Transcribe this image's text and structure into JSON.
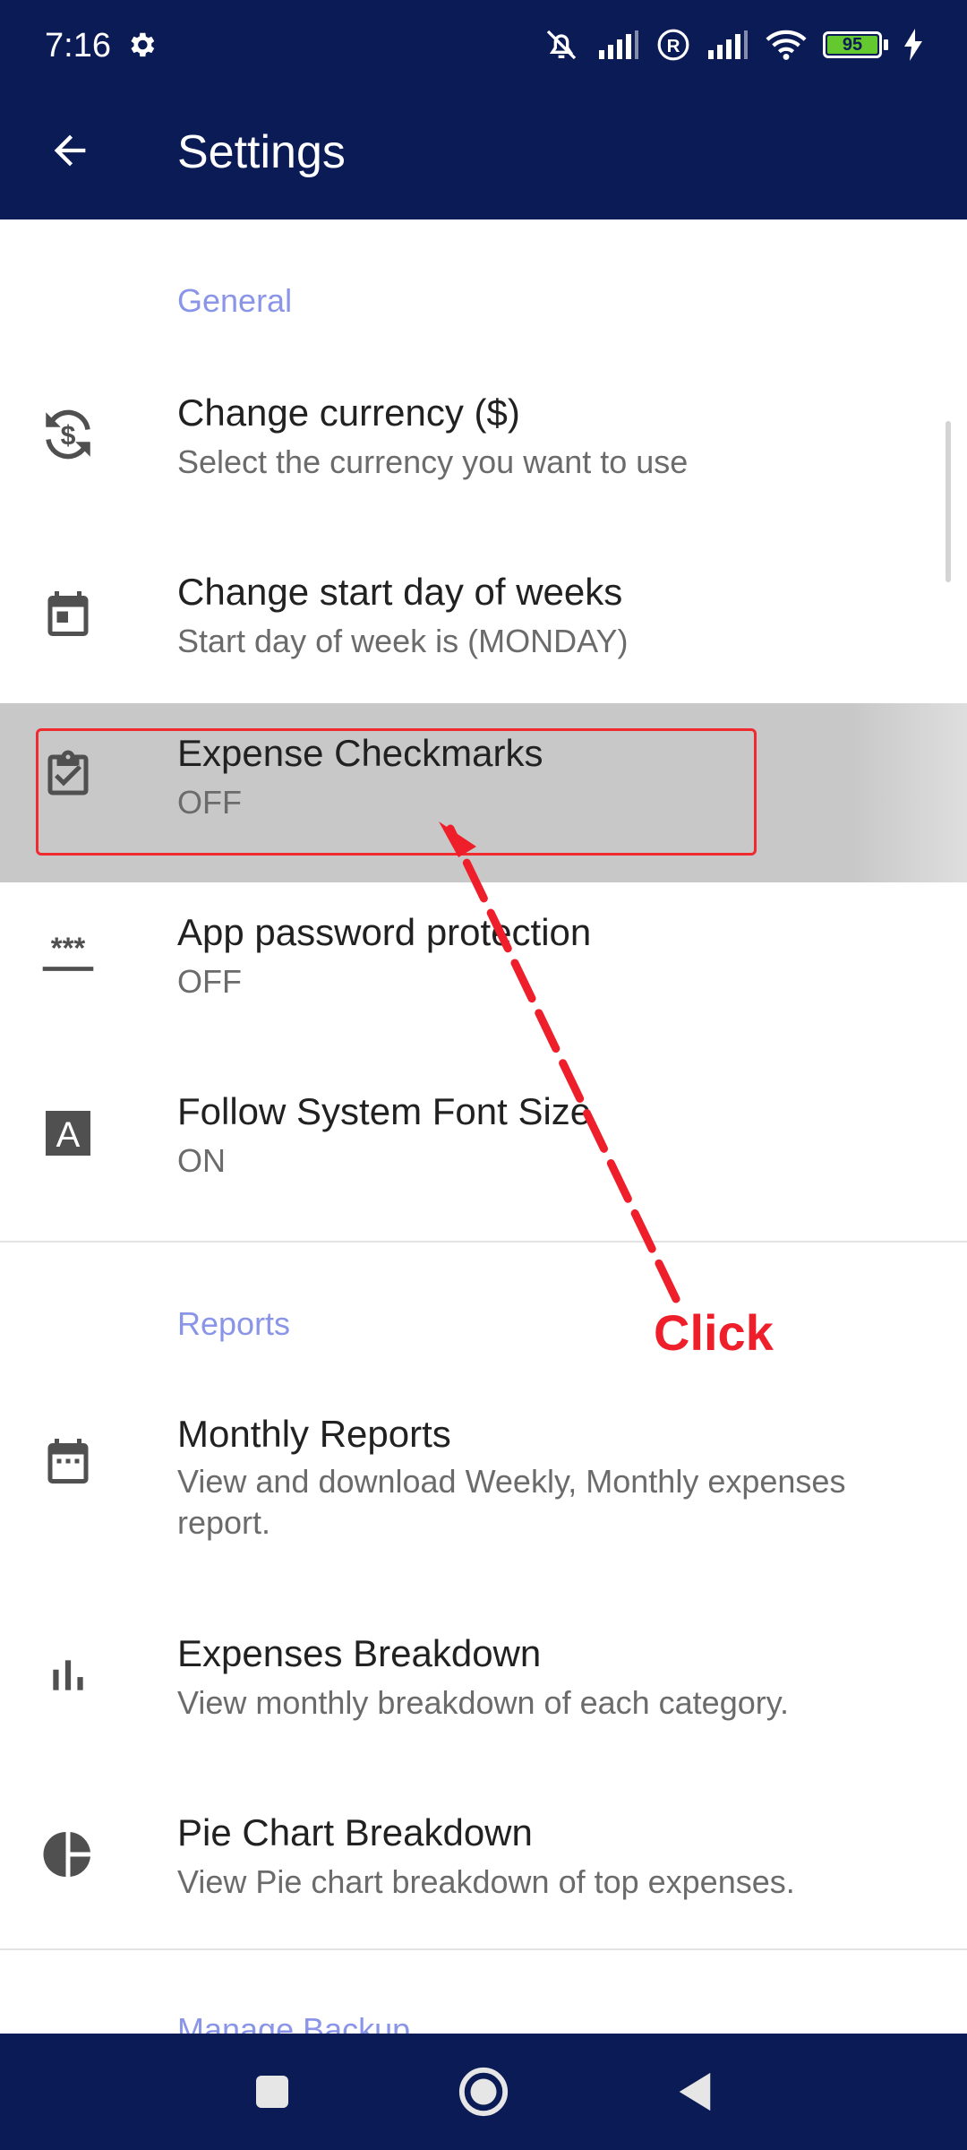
{
  "status_bar": {
    "time": "7:16",
    "battery": "95",
    "icons": [
      "gear-icon",
      "mute-icon",
      "signal-icon",
      "roaming-icon",
      "signal-icon",
      "wifi-icon",
      "battery-icon",
      "charging-icon"
    ]
  },
  "app_bar": {
    "title": "Settings",
    "back_icon": "arrow-back-icon"
  },
  "sections": {
    "general": {
      "header": "General",
      "items": [
        {
          "title": "Change currency ($)",
          "subtitle": "Select the currency you want to use",
          "icon": "currency-exchange-icon"
        },
        {
          "title": "Change start day of weeks",
          "subtitle": "Start day of week is (MONDAY)",
          "icon": "calendar-day-icon"
        },
        {
          "title": "Expense Checkmarks",
          "subtitle": "OFF",
          "icon": "clipboard-check-icon",
          "highlighted": true
        },
        {
          "title": "App password protection",
          "subtitle": "OFF",
          "icon": "password-icon"
        },
        {
          "title": "Follow System Font Size",
          "subtitle": "ON",
          "icon": "font-size-icon"
        }
      ]
    },
    "reports": {
      "header": "Reports",
      "items": [
        {
          "title": "Monthly Reports",
          "subtitle": "View and download Weekly, Monthly expenses report.",
          "icon": "calendar-month-icon"
        },
        {
          "title": "Expenses Breakdown",
          "subtitle": "View monthly breakdown of each category.",
          "icon": "bar-chart-icon"
        },
        {
          "title": "Pie Chart Breakdown",
          "subtitle": "View Pie chart breakdown of top expenses.",
          "icon": "pie-chart-icon"
        }
      ]
    },
    "backup": {
      "header": "Manage Backup"
    }
  },
  "annotation": {
    "label": "Click",
    "color": "#ee1f2a"
  },
  "nav_bar": {
    "buttons": [
      "recents-icon",
      "home-icon",
      "back-icon"
    ]
  },
  "colors": {
    "primary": "#0b1b55",
    "section_header": "#8b95e8",
    "highlight": "#c8c8c8",
    "annotation": "#ee1f2a"
  }
}
